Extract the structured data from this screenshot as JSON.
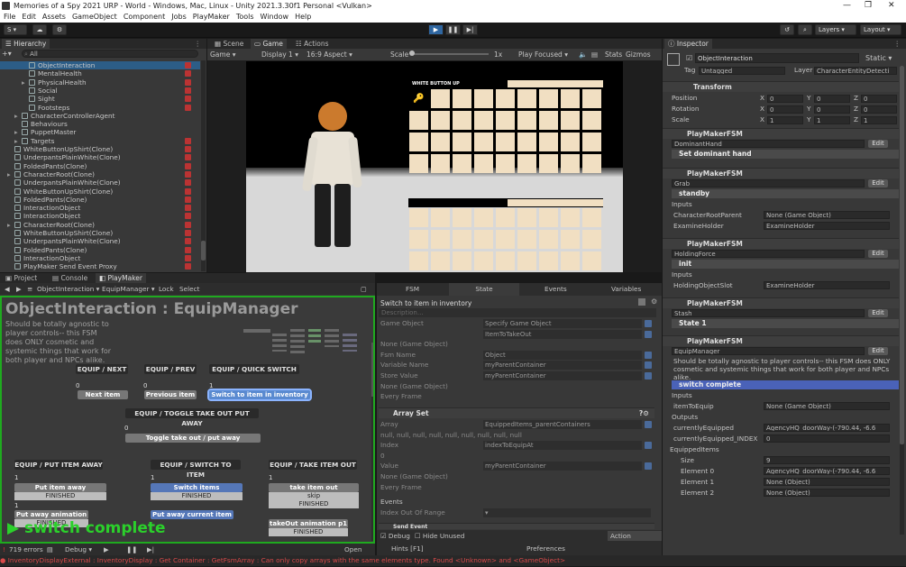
{
  "window": {
    "title": "Memories of a Spy 2021 URP - World - Windows, Mac, Linux - Unity 2021.3.30f1 Personal <Vulkan>",
    "min": "—",
    "max": "❐",
    "close": "✕"
  },
  "menu": [
    "File",
    "Edit",
    "Assets",
    "GameObject",
    "Component",
    "Jobs",
    "PlayMaker",
    "Tools",
    "Window",
    "Help"
  ],
  "toolbar": {
    "account": "S ▾",
    "layers": "Layers",
    "layout": "Layout"
  },
  "hierarchy": {
    "title": "Hierarchy",
    "search": "All",
    "rows": [
      {
        "label": "ObjectInteraction",
        "indent": 3,
        "sel": true,
        "pm": true
      },
      {
        "label": "MentalHealth",
        "indent": 3,
        "pm": true
      },
      {
        "label": "PhysicalHealth",
        "indent": 3,
        "pm": true,
        "arrow": true
      },
      {
        "label": "Social",
        "indent": 3,
        "pm": true
      },
      {
        "label": "Sight",
        "indent": 3,
        "pm": true
      },
      {
        "label": "Footsteps",
        "indent": 3,
        "pm": true
      },
      {
        "label": "CharacterControllerAgent",
        "indent": 2,
        "arrow": true
      },
      {
        "label": "Behaviours",
        "indent": 2
      },
      {
        "label": "PuppetMaster",
        "indent": 2,
        "arrow": true
      },
      {
        "label": "Targets",
        "indent": 2,
        "arrow": true,
        "pm": true
      },
      {
        "label": "WhiteButtonUpShirt(Clone)",
        "indent": 1,
        "pm": true
      },
      {
        "label": "UnderpantsPlainWhite(Clone)",
        "indent": 1,
        "pm": true
      },
      {
        "label": "FoldedPants(Clone)",
        "indent": 1,
        "pm": true
      },
      {
        "label": "CharacterRoot(Clone)",
        "indent": 1,
        "arrow": true,
        "pm": true
      },
      {
        "label": "UnderpantsPlainWhite(Clone)",
        "indent": 1,
        "pm": true
      },
      {
        "label": "WhiteButtonUpShirt(Clone)",
        "indent": 1,
        "pm": true
      },
      {
        "label": "FoldedPants(Clone)",
        "indent": 1,
        "pm": true
      },
      {
        "label": "InteractionObject",
        "indent": 1,
        "pm": true
      },
      {
        "label": "InteractionObject",
        "indent": 1,
        "pm": true
      },
      {
        "label": "CharacterRoot(Clone)",
        "indent": 1,
        "arrow": true,
        "pm": true
      },
      {
        "label": "WhiteButtonUpShirt(Clone)",
        "indent": 1,
        "pm": true
      },
      {
        "label": "UnderpantsPlainWhite(Clone)",
        "indent": 1,
        "pm": true
      },
      {
        "label": "FoldedPants(Clone)",
        "indent": 1,
        "pm": true
      },
      {
        "label": "InteractionObject",
        "indent": 1,
        "pm": true
      },
      {
        "label": "PlayMaker Send Event Proxy",
        "indent": 1,
        "pm": true
      }
    ]
  },
  "scene": {
    "tabs": [
      "Scene",
      "Game",
      "Actions"
    ],
    "game_dd": "Game",
    "display": "Display 1",
    "aspect": "16:9 Aspect",
    "scale_label": "Scale",
    "scale_val": "1x",
    "play_focused": "Play Focused",
    "stats": "Stats",
    "gizmos": "Gizmos",
    "inv_title": "WHITE BUTTON UP"
  },
  "bottom": {
    "tabs": [
      "Project",
      "Console",
      "PlayMaker"
    ]
  },
  "pm": {
    "crumb1": "ObjectInteraction",
    "crumb2": "EquipManager",
    "lock": "Lock",
    "select": "Select",
    "title": "ObjectInteraction : EquipManager",
    "desc": "Should be totally agnostic to player controls-- this FSM does ONLY cosmetic and systemic things that work for both player and NPCs alike.",
    "events": [
      "EQUIP / NEXT",
      "EQUIP / PREV",
      "EQUIP / QUICK SWITCH",
      "EQUIP / TOGGLE TAKE OUT PUT AWAY",
      "EQUIP / PUT ITEM AWAY",
      "EQUIP / SWITCH TO ITEM",
      "EQUIP / TAKE ITEM OUT"
    ],
    "states": [
      "Next item",
      "Previous item",
      "Switch to item in inventory",
      "Toggle take out / put away",
      "Put item away",
      "Switch items",
      "take item out",
      "Put away animation",
      "Put away current item",
      "takeOut animation p1"
    ],
    "trans": [
      "FINISHED",
      "FINISHED",
      "skip",
      "FINISHED",
      "FINISHED",
      "FINISHED"
    ],
    "nums": [
      "0",
      "0",
      "1",
      "0",
      "1",
      "1",
      "1",
      "1"
    ],
    "banner": "switch complete",
    "errors": "719 errors",
    "debug": "Debug ▾",
    "openlog": "Open Log"
  },
  "fsm": {
    "tabs": [
      "FSM",
      "State",
      "Events",
      "Variables"
    ],
    "state_name": "Switch to item in inventory",
    "desc_ph": "Description...",
    "rows": [
      {
        "l": "Game Object",
        "v": "Specify Game Object"
      },
      {
        "l": "",
        "v": "ItemToTakeOut"
      },
      {
        "l": "None (Game Object)",
        "v": ""
      },
      {
        "l": "Fsm Name",
        "v": "Object"
      },
      {
        "l": "Variable Name",
        "v": "myParentContainer"
      },
      {
        "l": "Store Value",
        "v": "myParentContainer"
      },
      {
        "l": "None (Game Object)",
        "v": ""
      },
      {
        "l": "Every Frame",
        "v": ""
      }
    ],
    "arrayset": "Array Set",
    "rows2": [
      {
        "l": "Array",
        "v": "EquippedItems_parentContainers"
      },
      {
        "l": "null, null, null, null, null, null, null, null, null",
        "v": ""
      },
      {
        "l": "Index",
        "v": "indexToEquipAt"
      },
      {
        "l": "0",
        "v": ""
      },
      {
        "l": "Value",
        "v": "myParentContainer"
      },
      {
        "l": "None (Game Object)",
        "v": ""
      },
      {
        "l": "Every Frame",
        "v": ""
      }
    ],
    "events_lbl": "Events",
    "ioor": "Index Out Of Range",
    "sendevent": "Send Event",
    "debug": "Debug",
    "hide": "Hide Unused",
    "browser": "Action Browser",
    "hints": "Hints [F1]",
    "prefs": "Preferences"
  },
  "inspector": {
    "title": "Inspector",
    "obj": "ObjectInteraction",
    "static": "Static",
    "tag_l": "Tag",
    "tag": "Untagged",
    "layer_l": "Layer",
    "layer": "CharacterEntityDetecti",
    "transform": "Transform",
    "pos": [
      "0",
      "0",
      "0"
    ],
    "rot": [
      "0",
      "0",
      "0"
    ],
    "scl": [
      "1",
      "1",
      "1"
    ],
    "pos_l": "Position",
    "rot_l": "Rotation",
    "scl_l": "Scale",
    "x": "X",
    "y": "Y",
    "z": "Z",
    "comp": "PlayMakerFSM",
    "edit": "Edit",
    "fsms": [
      {
        "name": "DominantHand",
        "state": "Set dominant hand"
      },
      {
        "name": "Grab",
        "state": "standby"
      },
      {
        "name": "HoldingForce",
        "state": "init"
      },
      {
        "name": "Stash",
        "state": "State 1"
      },
      {
        "name": "EquipManager",
        "state": "switch complete"
      }
    ],
    "inputs": "Inputs",
    "outputs": "Outputs",
    "grab_in": [
      {
        "l": "CharacterRootParent",
        "v": "None (Game Object)"
      },
      {
        "l": "ExamineHolder",
        "v": "ExamineHolder"
      }
    ],
    "hold_in": [
      {
        "l": "HoldingObjectSlot",
        "v": "ExamineHolder"
      }
    ],
    "eq_desc": "Should be totally agnostic to player controls-- this FSM does ONLY cosmetic and systemic things that work for both player and NPCs alike.",
    "eq_in": [
      {
        "l": "itemToEquip",
        "v": "None (Game Object)"
      }
    ],
    "eq_out": [
      {
        "l": "currentlyEquipped",
        "v": "AgencyHQ_doorWay-(-790.44, -6.6"
      },
      {
        "l": "currentlyEquipped_INDEX",
        "v": "0"
      }
    ],
    "equipped": "EquippedItems",
    "size_l": "Size",
    "size": "9",
    "elems": [
      {
        "l": "Element 0",
        "v": "AgencyHQ_doorWay-(-790.44, -6.6"
      },
      {
        "l": "Element 1",
        "v": "None (Object)"
      },
      {
        "l": "Element 2",
        "v": "None (Object)"
      }
    ]
  },
  "status": "InventoryDisplayExternal : InventoryDisplay : Get Container : GetFsmArray : Can only copy arrays with the same elements type. Found <Unknown> and <GameObject>",
  "colors": {
    "accent": "#2f66a0",
    "green": "#2bd02b",
    "error": "#d33"
  }
}
